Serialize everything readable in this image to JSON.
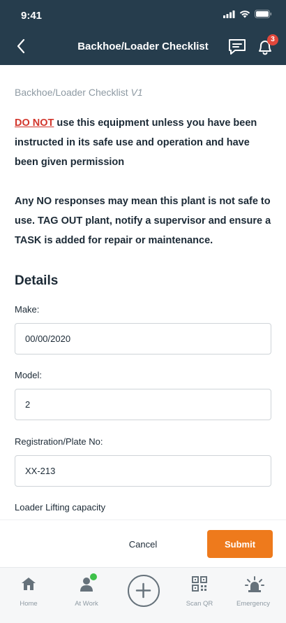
{
  "status_bar": {
    "time": "9:41"
  },
  "header": {
    "title": "Backhoe/Loader Checklist",
    "notification_count": "3"
  },
  "form": {
    "title": "Backhoe/Loader Checklist",
    "version": "V1",
    "warning_lead": "DO NOT",
    "warning_rest": " use this equipment unless you have been instructed in its safe use and operation and have been given permission",
    "notice": "Any NO responses may mean this plant is not safe to use. TAG OUT plant, notify a supervisor and ensure a TASK is added for repair or maintenance.",
    "section_title": "Details",
    "fields": [
      {
        "label": "Make:",
        "value": "00/00/2020"
      },
      {
        "label": "Model:",
        "value": "2"
      },
      {
        "label": "Registration/Plate No:",
        "value": "XX-213"
      },
      {
        "label": "Loader Lifting capacity"
      }
    ]
  },
  "footer": {
    "cancel_label": "Cancel",
    "submit_label": "Submit"
  },
  "tabbar": {
    "home": "Home",
    "at_work": "At Work",
    "scan_qr": "Scan QR",
    "emergency": "Emergency"
  },
  "colors": {
    "header_bg": "#263d4d",
    "accent": "#ee7a1c",
    "danger": "#d2352b",
    "badge": "#e0473b",
    "online": "#3ec14a"
  }
}
